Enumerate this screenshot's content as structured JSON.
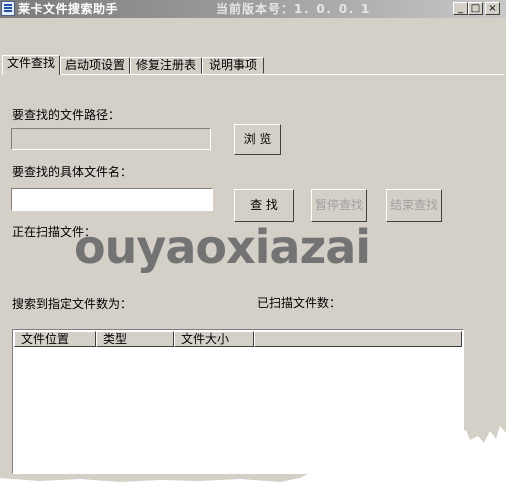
{
  "window": {
    "title": "莱卡文件搜索助手",
    "version_label": "当前版本号：1．0．0．1",
    "buttons": {
      "minimize": "_",
      "maximize": "□",
      "close": "×"
    }
  },
  "tabs": [
    {
      "label": "文件查找",
      "active": true
    },
    {
      "label": "启动项设置",
      "active": false
    },
    {
      "label": "修复注册表",
      "active": false
    },
    {
      "label": "说明事项",
      "active": false
    }
  ],
  "form": {
    "path_label": "要查找的文件路径：",
    "path_value": "",
    "browse_button": "浏 览",
    "filename_label": "要查找的具体文件名：",
    "filename_value": "",
    "search_button": "查 找",
    "pause_button": "暂停查找",
    "stop_button": "结束查找",
    "scanning_label": "正在扫描文件："
  },
  "watermark": "ouyaoxiazai",
  "stats": {
    "found_label": "搜索到指定文件数为：",
    "scanned_label": "已扫描文件数："
  },
  "results": {
    "columns": [
      "文件位置",
      "类型",
      "文件大小",
      ""
    ],
    "rows": []
  }
}
